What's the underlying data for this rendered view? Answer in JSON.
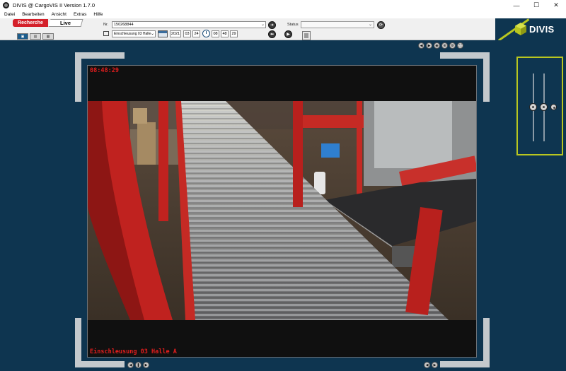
{
  "window": {
    "title": "DIVIS @ CargoVIS II Version 1.7.0",
    "minimize": "—",
    "maximize": "☐",
    "close": "✕"
  },
  "menu": {
    "items": [
      "Datei",
      "Bearbeiten",
      "Ansicht",
      "Extras",
      "Hilfe"
    ]
  },
  "toolbar": {
    "tab_recherche": "Recherche",
    "tab_live": "Live",
    "nr_label": "Nr.",
    "nr_value": "150268844",
    "location_value": "Einschleusung 03 Halle",
    "date": {
      "year": "2021",
      "month": "03",
      "day": "24"
    },
    "time": {
      "hour": "08",
      "minute": "48",
      "second": "29"
    },
    "status_label": "Status"
  },
  "brand": {
    "name": "DIVIS"
  },
  "video": {
    "timestamp": "08:48:29",
    "camera_label": "Einschleusung 03 Halle A"
  },
  "colors": {
    "background": "#0e3550",
    "accent_red": "#d4202a",
    "brand_green": "#b8c620",
    "overlay_text": "#e21e1e"
  }
}
